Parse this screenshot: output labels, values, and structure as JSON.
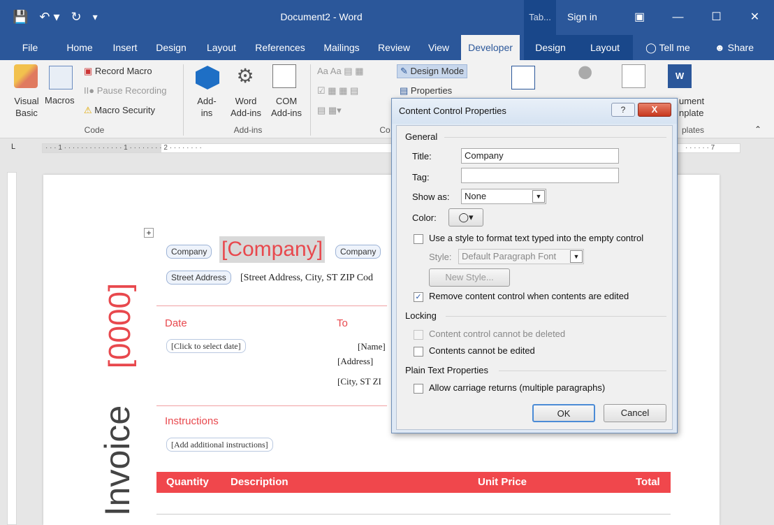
{
  "titlebar": {
    "doc_title": "Document2 - Word",
    "context_tab": "Tab...",
    "sign_in": "Sign in",
    "qat_icons": [
      "save-icon",
      "undo-icon",
      "redo-icon",
      "customize-icon"
    ]
  },
  "tabs": [
    {
      "label": "File"
    },
    {
      "label": "Home"
    },
    {
      "label": "Insert"
    },
    {
      "label": "Design"
    },
    {
      "label": "Layout"
    },
    {
      "label": "References"
    },
    {
      "label": "Mailings"
    },
    {
      "label": "Review"
    },
    {
      "label": "View"
    },
    {
      "label": "Developer"
    },
    {
      "label": "Design"
    },
    {
      "label": "Layout"
    },
    {
      "label": "Tell me"
    },
    {
      "label": "Share"
    }
  ],
  "ribbon": {
    "code": {
      "visual_basic": "Visual Basic",
      "macros": "Macros",
      "record_macro": "Record Macro",
      "pause_recording": "Pause Recording",
      "macro_security": "Macro Security",
      "label": "Code"
    },
    "addins": {
      "addins": "Add-ins",
      "word_addins": "Word Add-ins",
      "com_addins": "COM Add-ins",
      "label": "Add-ins"
    },
    "controls": {
      "design_mode": "Design Mode",
      "properties": "Properties",
      "label": "Co"
    },
    "template": {
      "document": "ument",
      "template": "nplate",
      "label": "plates"
    }
  },
  "ruler": {
    "marks": "· · · 1 · · · · · · · · · ·  · · · · 1 · · · · · · · · 2 · · · · · · · ·",
    "right_marks": "· · · · · · 7"
  },
  "document": {
    "company_tag": "Company",
    "company_text": "[Company]",
    "company_tag_end": "Company",
    "street_tag": "Street Address",
    "street_text": "[Street Address, City, ST ZIP Cod",
    "invoice_number": "[0000]",
    "invoice_word": "Invoice",
    "date_label": "Date",
    "date_text": "[Click to select date]",
    "to_label": "To",
    "to_name": "[Name]",
    "to_address": "[Address]",
    "to_city": "[City, ST  ZI",
    "instructions_label": "Instructions",
    "instructions_text": "[Add additional instructions]",
    "table_headers": [
      "Quantity",
      "Description",
      "Unit Price",
      "Total"
    ]
  },
  "dialog": {
    "title": "Content Control Properties",
    "help": "?",
    "close": "X",
    "general": "General",
    "title_label": "Title:",
    "title_value": "Company",
    "tag_label": "Tag:",
    "tag_value": "",
    "showas_label": "Show as:",
    "showas_value": "None",
    "color_label": "Color:",
    "use_style": "Use a style to format text typed into the empty control",
    "style_label": "Style:",
    "style_value": "Default Paragraph Font",
    "new_style": "New Style...",
    "remove_cc": "Remove content control when contents are edited",
    "locking": "Locking",
    "cannot_delete": "Content control cannot be deleted",
    "cannot_edit": "Contents cannot be edited",
    "plain_text": "Plain Text Properties",
    "allow_returns": "Allow carriage returns (multiple paragraphs)",
    "ok": "OK",
    "cancel": "Cancel",
    "checks": {
      "use_style": false,
      "remove_cc": true,
      "cannot_delete": false,
      "cannot_edit": false,
      "allow_returns": false
    }
  },
  "colors": {
    "word_blue": "#2b579a",
    "accent_red": "#f0474c"
  }
}
